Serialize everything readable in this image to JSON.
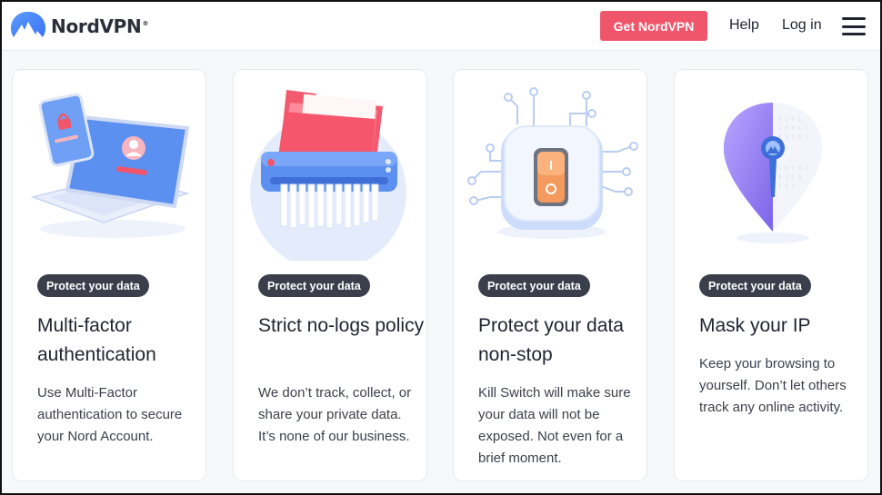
{
  "header": {
    "logo_text": "NordVPN",
    "logo_mark": "®",
    "cta_label": "Get NordVPN",
    "help_label": "Help",
    "login_label": "Log in",
    "menu_icon": "hamburger-menu-icon"
  },
  "colors": {
    "brand_blue": "#4687ff",
    "cta_red": "#f0566b",
    "badge_dark": "#3a3f4b"
  },
  "cards": [
    {
      "illustration": "laptop-phone-lock-illustration",
      "badge": "Protect your data",
      "title": "Multi-factor authentication",
      "description": "Use Multi-Factor authentication to secure your Nord Account."
    },
    {
      "illustration": "shredder-folder-illustration",
      "badge": "Protect your data",
      "title": "Strict no-logs policy",
      "description": "We don’t track, collect, or share your private data. It’s none of our business."
    },
    {
      "illustration": "kill-switch-illustration",
      "badge": "Protect your data",
      "title": "Protect your data non-stop",
      "description": "Kill Switch will make sure your data will not be exposed. Not even for a brief moment."
    },
    {
      "illustration": "location-pin-mask-illustration",
      "badge": "Protect your data",
      "title": "Mask your IP",
      "description": "Keep your browsing to yourself. Don’t let others track any online activity."
    }
  ]
}
